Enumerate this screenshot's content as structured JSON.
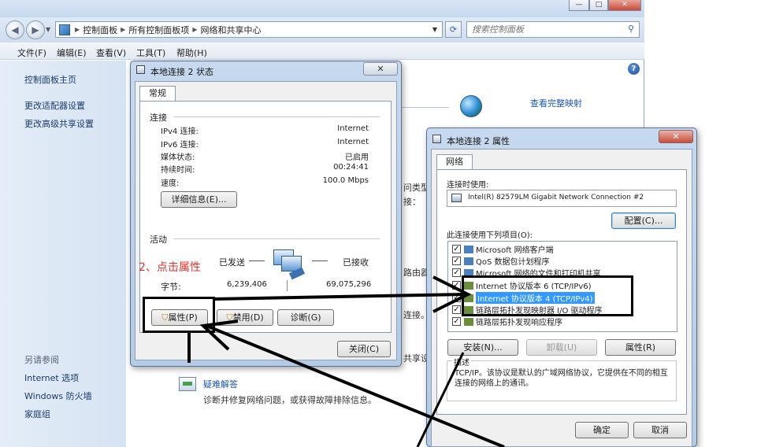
{
  "explorer": {
    "breadcrumb": [
      "控制面板",
      "所有控制面板项",
      "网络和共享中心"
    ],
    "search_placeholder": "搜索控制面板",
    "menu": [
      "文件(F)",
      "编辑(E)",
      "查看(V)",
      "工具(T)",
      "帮助(H)"
    ],
    "sidebar": {
      "links": [
        "控制面板主页",
        "更改适配器设置",
        "更改高级共享设置"
      ],
      "see_also_title": "另请参阅",
      "see_also": [
        "Internet 选项",
        "Windows 防火墙",
        "家庭组"
      ]
    },
    "main": {
      "view_full_map": "查看完整映射",
      "frag_type": "问类型：",
      "frag_connect": "接：",
      "frag_router": "路由器",
      "frag_connect2": "连接。",
      "frag_share": "共享设",
      "troubleshoot_title": "疑难解答",
      "troubleshoot_desc": "诊断并修复网络问题，或获得故障排除信息。"
    }
  },
  "status_dialog": {
    "title": "本地连接 2 状态",
    "tab": "常规",
    "connection_group": "连接",
    "rows": [
      {
        "label": "IPv4 连接:",
        "value": "Internet"
      },
      {
        "label": "IPv6 连接:",
        "value": "Internet"
      },
      {
        "label": "媒体状态:",
        "value": "已启用"
      },
      {
        "label": "持续时间:",
        "value": "00:24:41"
      },
      {
        "label": "速度:",
        "value": "100.0 Mbps"
      }
    ],
    "details_button": "详细信息(E)...",
    "activity_group": "活动",
    "sent_label": "已发送",
    "received_label": "已接收",
    "bytes_label": "字节:",
    "bytes_sent": "6,239,406",
    "bytes_received": "69,075,296",
    "properties_button": "属性(P)",
    "disable_button": "禁用(D)",
    "diagnose_button": "诊断(G)",
    "close_button": "关闭(C)",
    "annotation": "2、点击属性"
  },
  "props_dialog": {
    "title": "本地连接 2 属性",
    "tab": "网络",
    "connect_using_label": "连接时使用:",
    "adapter": "Intel(R) 82579LM Gigabit Network Connection #2",
    "configure_button": "配置(C)...",
    "items_label": "此连接使用下列项目(O):",
    "items": [
      {
        "label": "Microsoft 网络客户端",
        "checked": true,
        "selected": false
      },
      {
        "label": "QoS 数据包计划程序",
        "checked": true,
        "selected": false
      },
      {
        "label": "Microsoft 网络的文件和打印机共享",
        "checked": true,
        "selected": false
      },
      {
        "label": "Internet 协议版本 6 (TCP/IPv6)",
        "checked": true,
        "selected": false
      },
      {
        "label": "Internet 协议版本 4 (TCP/IPv4)",
        "checked": true,
        "selected": true
      },
      {
        "label": "链路层拓扑发现映射器 I/O 驱动程序",
        "checked": true,
        "selected": false
      },
      {
        "label": "链路层拓扑发现响应程序",
        "checked": true,
        "selected": false
      }
    ],
    "install_button": "安装(N)...",
    "uninstall_button": "卸载(U)",
    "properties_button": "属性(R)",
    "description_group": "描述",
    "description": "TCP/IP。该协议是默认的广域网络协议，它提供在不同的相互连接的网络上的通讯。",
    "ok_button": "确定",
    "cancel_button": "取消"
  }
}
